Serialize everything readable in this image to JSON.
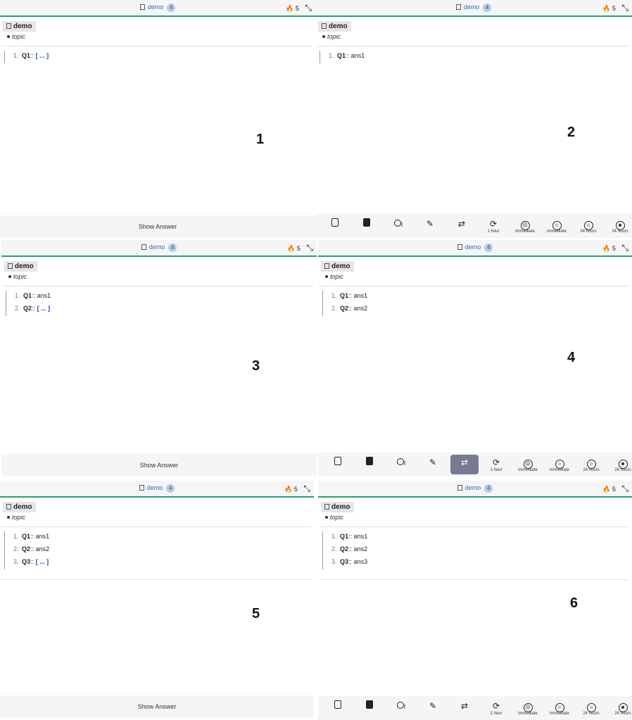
{
  "panels": [
    {
      "deck": "demo",
      "deck_count": "4",
      "fire_count": "5",
      "title": "demo",
      "topic": "topic",
      "items": [
        {
          "num": "1.",
          "q": "Q1",
          "sep": "::",
          "a": "[ ... ]",
          "cloze": true
        }
      ],
      "big": "1",
      "footer": "answer",
      "show_answer": "Show Answer"
    },
    {
      "deck": "demo",
      "deck_count": "4",
      "fire_count": "5",
      "title": "demo",
      "topic": "topic",
      "items": [
        {
          "num": "1.",
          "q": "Q1",
          "sep": "::",
          "a": "ans1",
          "cloze": false
        }
      ],
      "big": "2",
      "footer": "toolbar"
    },
    {
      "deck": "demo",
      "deck_count": "4",
      "fire_count": "5",
      "title": "demo",
      "topic": "topic",
      "items": [
        {
          "num": "1.",
          "q": "Q1",
          "sep": "::",
          "a": "ans1",
          "cloze": false
        },
        {
          "num": "2.",
          "q": "Q2",
          "sep": "::",
          "a": "[ ... ]",
          "cloze": true
        }
      ],
      "big": "3",
      "footer": "answer",
      "show_answer": "Show Answer"
    },
    {
      "deck": "demo",
      "deck_count": "4",
      "fire_count": "5",
      "title": "demo",
      "topic": "topic",
      "items": [
        {
          "num": "1.",
          "q": "Q1",
          "sep": "::",
          "a": "ans1",
          "cloze": false
        },
        {
          "num": "2.",
          "q": "Q2",
          "sep": "::",
          "a": "ans2",
          "cloze": false
        }
      ],
      "big": "4",
      "footer": "toolbar",
      "active_tool": "swap"
    },
    {
      "deck": "demo",
      "deck_count": "4",
      "fire_count": "5",
      "title": "demo",
      "topic": "topic",
      "items": [
        {
          "num": "1.",
          "q": "Q1",
          "sep": "::",
          "a": "ans1",
          "cloze": false
        },
        {
          "num": "2.",
          "q": "Q2",
          "sep": "::",
          "a": "ans2",
          "cloze": false
        },
        {
          "num": "3.",
          "q": "Q3",
          "sep": "::",
          "a": "[ ... ]",
          "cloze": true
        }
      ],
      "big": "5",
      "footer": "answer",
      "show_answer": "Show Answer"
    },
    {
      "deck": "demo",
      "deck_count": "4",
      "fire_count": "5",
      "title": "demo",
      "topic": "topic",
      "items": [
        {
          "num": "1.",
          "q": "Q1",
          "sep": "::",
          "a": "ans1",
          "cloze": false
        },
        {
          "num": "2.",
          "q": "Q2",
          "sep": "::",
          "a": "ans2",
          "cloze": false
        },
        {
          "num": "3.",
          "q": "Q3",
          "sep": "::",
          "a": "ans3",
          "cloze": false
        }
      ],
      "big": "6",
      "footer": "toolbar"
    }
  ],
  "toolbar": [
    {
      "id": "copy",
      "icon": "copy-card-icon",
      "caption": ""
    },
    {
      "id": "cards",
      "icon": "cards-icon",
      "caption": ""
    },
    {
      "id": "schedule",
      "icon": "clock-info-icon",
      "caption": ""
    },
    {
      "id": "edit",
      "icon": "pencil-icon",
      "caption": ""
    },
    {
      "id": "swap",
      "icon": "swap-arrows-icon",
      "caption": ""
    },
    {
      "id": "again",
      "icon": "refresh-icon",
      "caption": "1 hour"
    },
    {
      "id": "hard",
      "icon": "sad-face-icon",
      "caption": "immediate"
    },
    {
      "id": "good",
      "icon": "neutral-face-icon",
      "caption": "immediate"
    },
    {
      "id": "easy",
      "icon": "smile-face-icon",
      "caption": "24 hours"
    },
    {
      "id": "perfect",
      "icon": "happy-face-icon",
      "caption": "24 hours"
    }
  ],
  "colors": {
    "accent": "#2e9e68",
    "cloze": "#1a3fc7",
    "active_button": "#787a92",
    "badge": "#b6cbe6"
  }
}
